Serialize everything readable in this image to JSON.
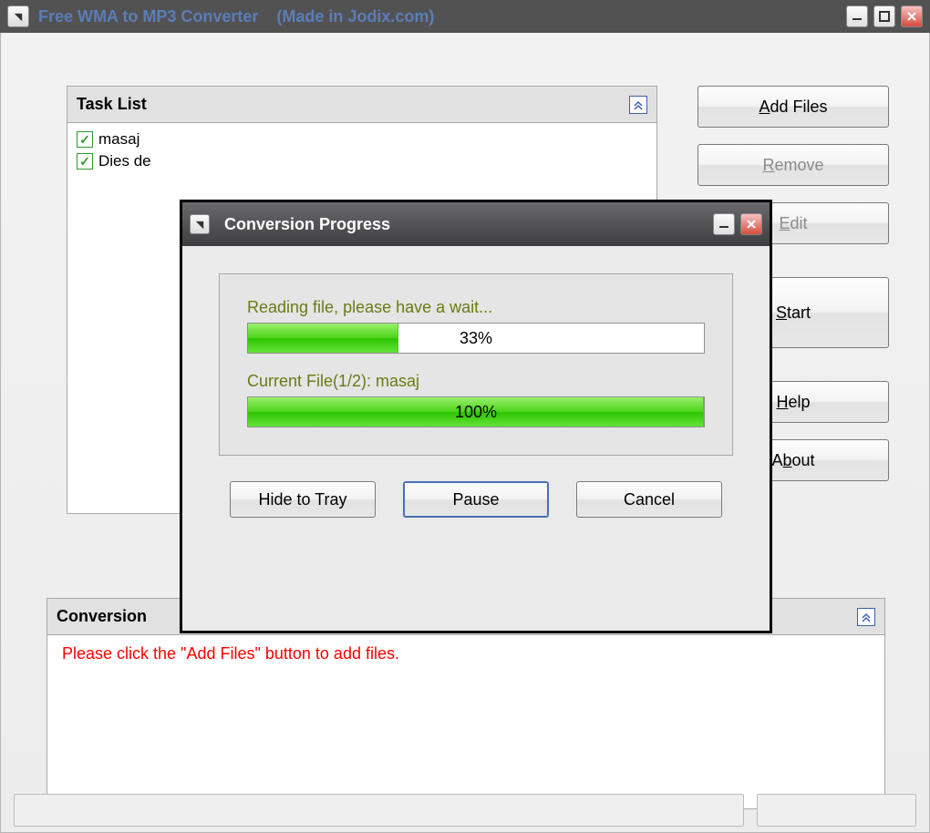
{
  "colors": {
    "accent_link": "#5b7db9",
    "olive": "#6b7a13",
    "red": "#ff0000"
  },
  "main": {
    "title_a": "Free WMA to MP3 Converter",
    "title_b": "(Made in Jodix.com)"
  },
  "task_panel": {
    "title": "Task List"
  },
  "tasks": [
    {
      "label": "masaj",
      "checked": true
    },
    {
      "label": "Dies de",
      "checked": true
    }
  ],
  "buttons": {
    "add": "Add Files",
    "remove": "Remove",
    "edit": "Edit",
    "start": "Start",
    "help": "Help",
    "about": "About"
  },
  "conversion_panel": {
    "title": "Conversion",
    "hint": "Please click the \"Add Files\" button to add files."
  },
  "dialog": {
    "title": "Conversion Progress",
    "reading_label": "Reading file, please have a wait...",
    "overall_percent": 33,
    "overall_text": "33%",
    "current_label": "Current File(1/2): masaj",
    "current_percent": 100,
    "current_text": "100%",
    "hide": "Hide to Tray",
    "pause": "Pause",
    "cancel": "Cancel"
  }
}
